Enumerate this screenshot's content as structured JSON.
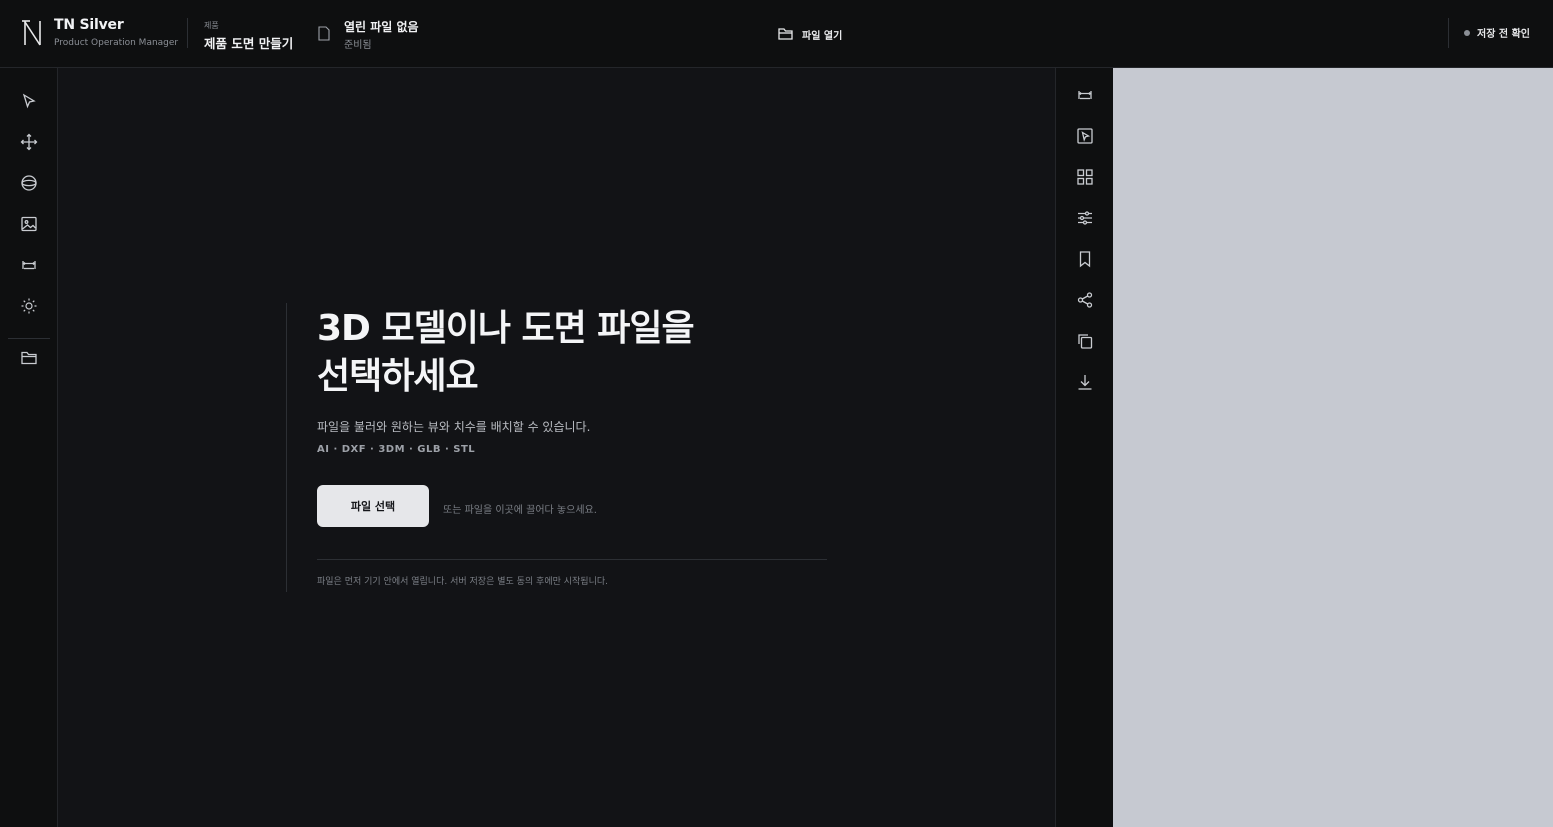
{
  "brand": {
    "name": "TN Silver",
    "subtitle": "Product Operation Manager"
  },
  "crumb": {
    "label": "제품",
    "title": "제품 도면 만들기"
  },
  "file": {
    "title": "열린 파일 없음",
    "status": "준비됨"
  },
  "header": {
    "open_label": "파일 열기",
    "save_check_label": "저장 전 확인"
  },
  "left_tools": [
    {
      "name": "select-icon"
    },
    {
      "name": "move-icon"
    },
    {
      "name": "orbit-icon"
    },
    {
      "name": "image-icon"
    },
    {
      "name": "dimension-icon"
    },
    {
      "name": "light-icon"
    },
    {
      "name": "folder-icon"
    }
  ],
  "right_tools": [
    {
      "name": "dimension-icon"
    },
    {
      "name": "view-select-icon"
    },
    {
      "name": "grid-icon"
    },
    {
      "name": "sliders-icon"
    },
    {
      "name": "bookmark-icon"
    },
    {
      "name": "share-icon"
    },
    {
      "name": "copy-icon"
    },
    {
      "name": "download-icon"
    }
  ],
  "main": {
    "title_line1": "3D 모델이나 도면 파일을",
    "title_line2": "선택하세요",
    "description": "파일을 불러와 원하는 뷰와 치수를 배치할 수 있습니다.",
    "formats": "AI · DXF · 3DM · GLB · STL",
    "select_button": "파일 선택",
    "drop_hint": "또는 파일을 이곳에 끌어다 놓으세요.",
    "footnote": "파일은 먼저 기기 안에서 열립니다. 서버 저장은 별도 동의 후에만 시작됩니다."
  },
  "colors": {
    "background": "#111214",
    "toolbar": "#0e0f10",
    "preview": "#c6c9d1",
    "button": "#e6e7ea"
  }
}
